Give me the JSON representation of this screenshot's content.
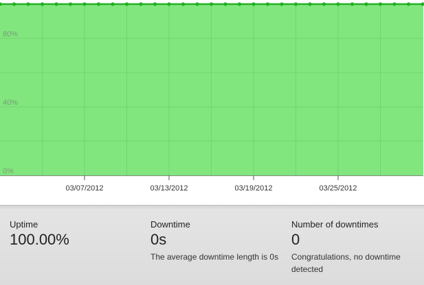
{
  "chart_data": {
    "type": "area",
    "y_tick_labels": [
      "0%",
      "40%",
      "80%"
    ],
    "x_tick_labels": [
      "03/07/2012",
      "03/13/2012",
      "03/19/2012",
      "03/25/2012"
    ],
    "ylim": [
      0,
      100
    ],
    "series": [
      {
        "values": [
          100,
          100,
          100,
          100,
          100,
          100,
          100,
          100,
          100,
          100,
          100,
          100,
          100,
          100,
          100,
          100,
          100,
          100,
          100,
          100,
          100,
          100,
          100,
          100,
          100,
          100,
          100,
          100,
          100,
          100,
          100
        ]
      }
    ],
    "colors": {
      "fill": "#82e67f",
      "line": "#22b022",
      "marker": "#22b022",
      "grid": "#72d46f"
    },
    "grid": true
  },
  "stats": {
    "uptime": {
      "label": "Uptime",
      "value": "100.00%"
    },
    "downtime": {
      "label": "Downtime",
      "value": "0s",
      "desc": "The average downtime length is 0s"
    },
    "count": {
      "label": "Number of downtimes",
      "value": "0",
      "desc": "Congratulations, no downtime detected"
    }
  }
}
